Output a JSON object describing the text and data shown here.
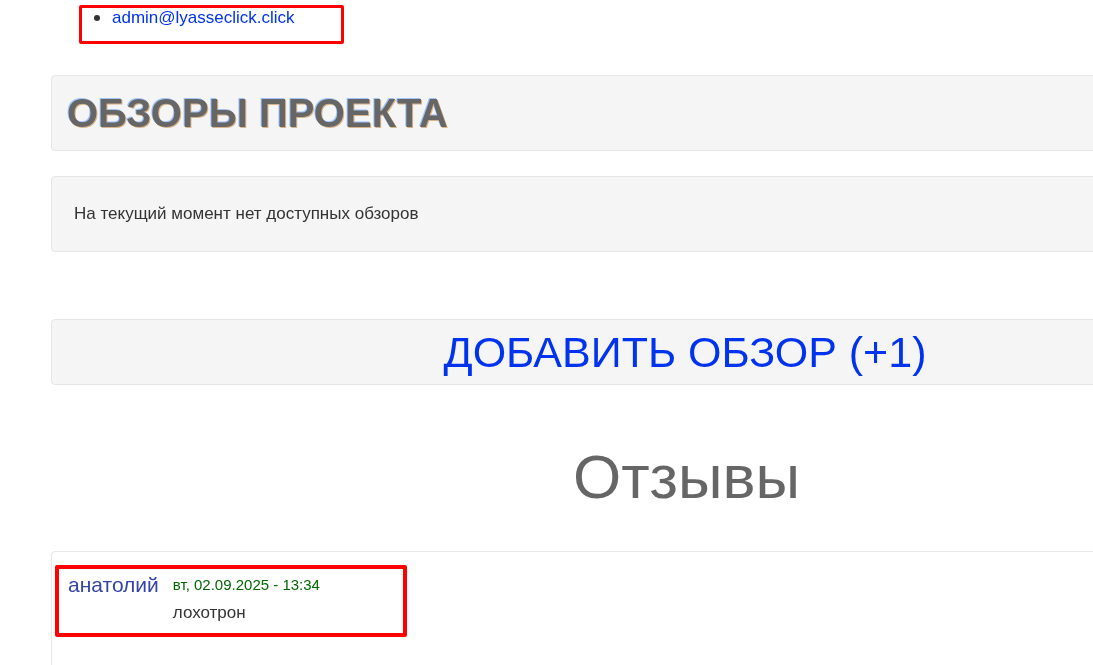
{
  "contacts": [
    {
      "email": "admin@lyasseclick.click",
      "highlighted": true
    }
  ],
  "reviews_section": {
    "title": "ОБЗОРЫ ПРОЕКТА",
    "empty_message": "На текущий момент нет доступных обзоров",
    "add_link": "ДОБАВИТЬ ОБЗОР (+1)"
  },
  "comments_section": {
    "title": "Отзывы",
    "comments": [
      {
        "author": "анатолий",
        "date": "вт, 02.09.2025 - 13:34",
        "text": "лохотрон",
        "highlighted": true
      }
    ]
  }
}
